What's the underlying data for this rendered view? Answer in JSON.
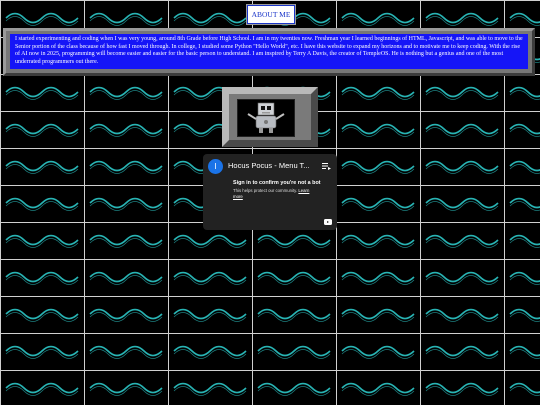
{
  "nav": {
    "about_label": "ABOUT ME"
  },
  "bio": {
    "text": "I started experimenting and coding when I was very young, around 8th Grade before High School. I am in my twenties now. Freshman year I learned beginnings of HTML, Javascript, and was able to move to the Senior portion of the class because of how fast I moved through. In college, I studied some Python \"Hello World\", etc. I have this website to expand my horizons and to motivate me to keep coding. With the rise of AI now in 2025, programming will become easier and easier for the basic person to understand. I am inspired by Terry A Davis, the creator of TempleOS. He is nothing but a genius and one of the most underrated programmers out there."
  },
  "colors": {
    "bio_bg": "#1515f7",
    "accent_link": "#1a35c9",
    "wave": "#28b4b4"
  },
  "video": {
    "avatar_letter": "I",
    "title": "Hocus Pocus - Menu T...",
    "heading": "Sign in to confirm you're not a bot",
    "subtext": "This helps protect our community.",
    "link": "Learn more",
    "icons": [
      "channel-avatar-icon",
      "playlist-icon",
      "youtube-logo-icon"
    ]
  },
  "decor": {
    "robot": "robot-image",
    "background": "wave-tile-pattern"
  }
}
